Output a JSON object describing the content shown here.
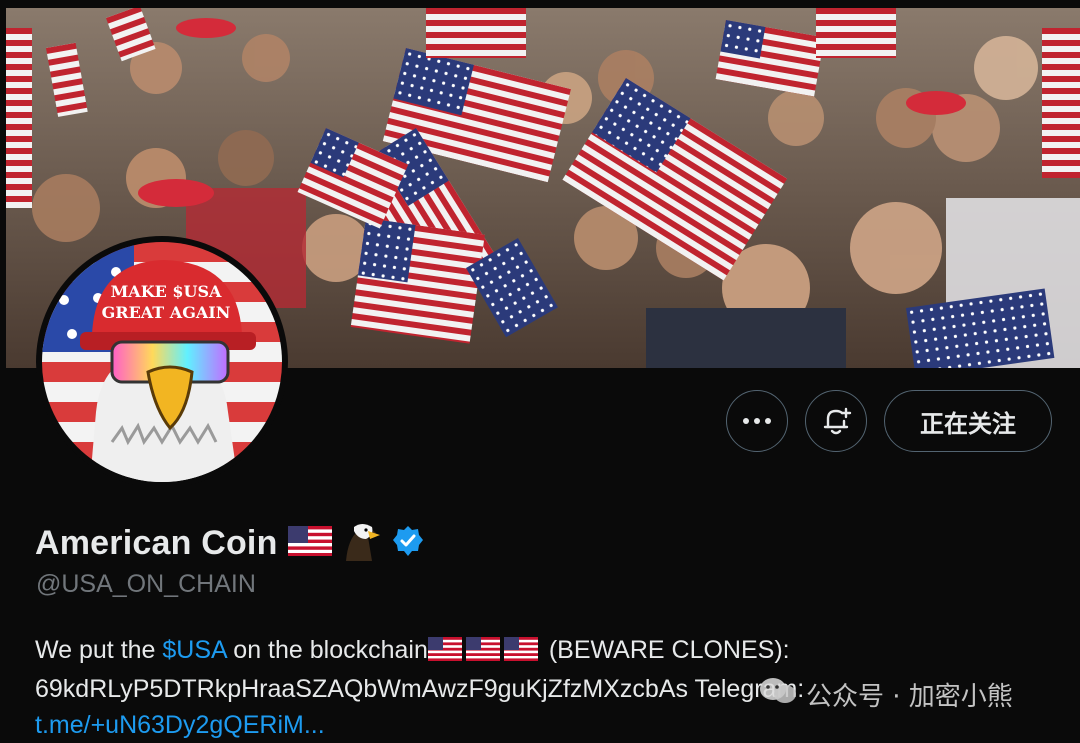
{
  "banner": {
    "image": "crowd waving american flags"
  },
  "avatar": {
    "hat_text_line1": "MAKE $USA",
    "hat_text_line2": "GREAT AGAIN"
  },
  "actions": {
    "more_icon": "ellipsis-icon",
    "notify_icon": "bell-plus-icon",
    "follow_label": "正在关注"
  },
  "profile": {
    "display_name": "American Coin",
    "name_emojis": [
      "us-flag-icon",
      "eagle-icon"
    ],
    "verified_icon": "verified-badge-icon",
    "handle": "@USA_ON_CHAIN"
  },
  "bio": {
    "prefix": "We put the ",
    "ticker": "$USA",
    "middle": " on the blockchain",
    "suffix": " (BEWARE CLONES):",
    "line2": "69kdRLyP5DTRkpHraaSZAQbWmAwzF9guKjZfzMXzcbAs Telegram:",
    "link": "t.me/+uN63Dy2gQERiM..."
  },
  "watermark": {
    "text": "公众号 · 加密小熊"
  },
  "colors": {
    "background": "#0a0a0a",
    "link": "#1d9bf0",
    "verified": "#1d9bf0",
    "muted": "#71767b",
    "text": "#e7e9ea"
  }
}
